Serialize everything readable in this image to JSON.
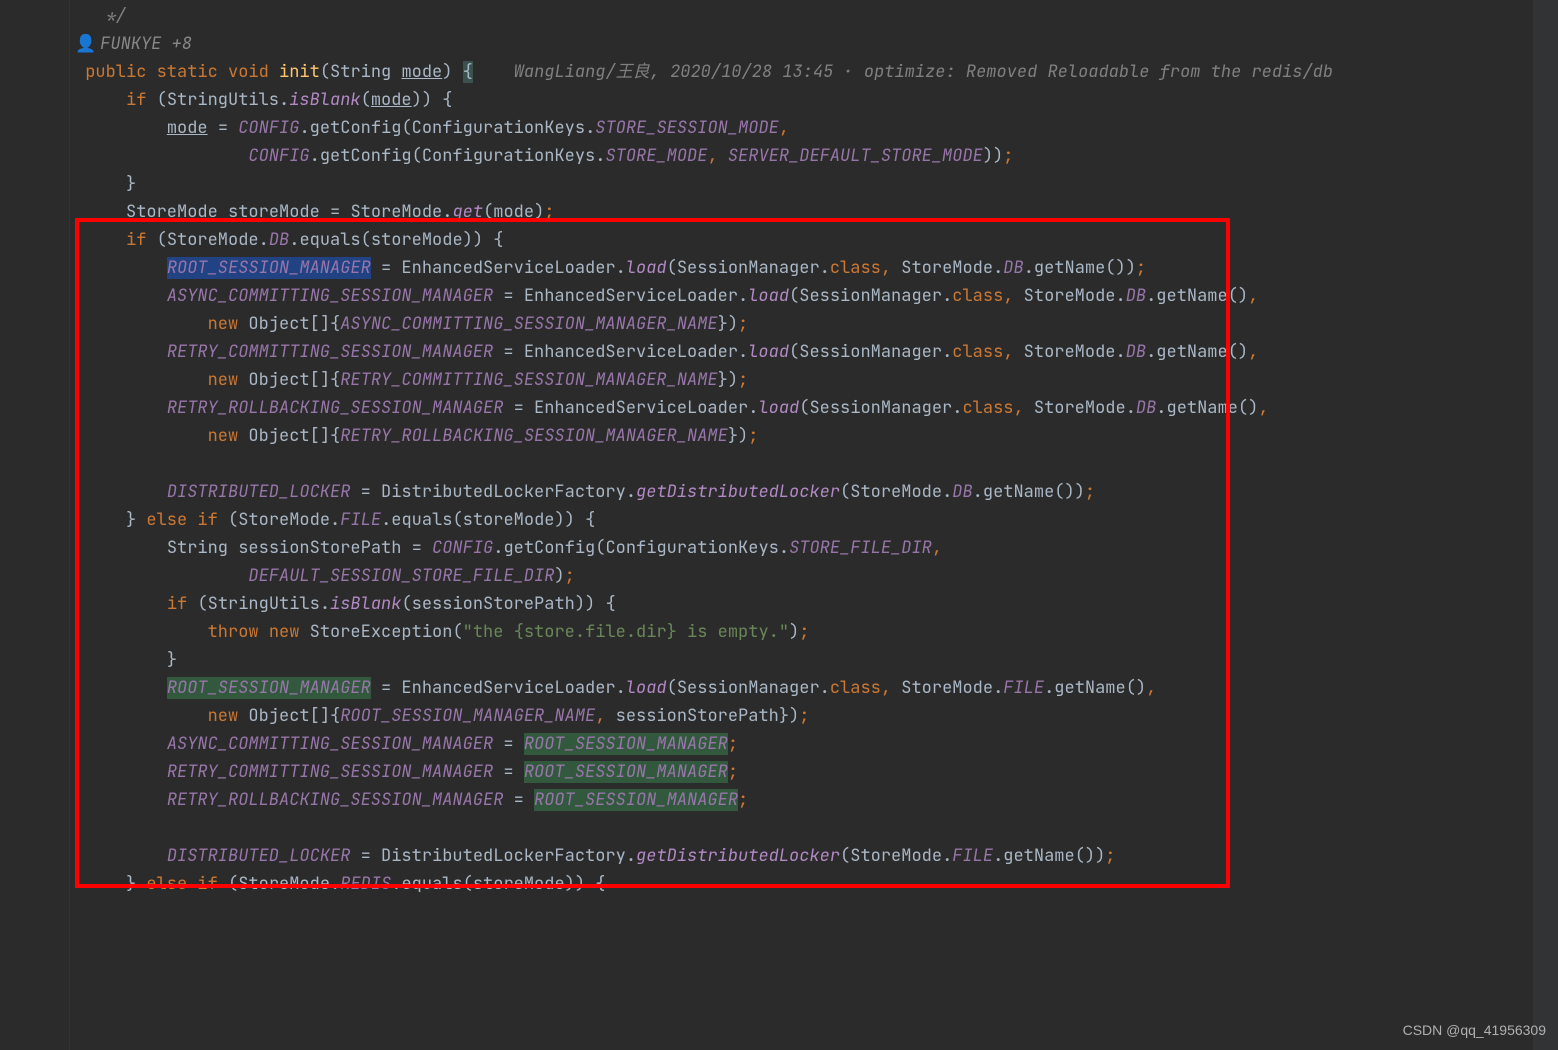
{
  "author_line": "FUNKYE +8",
  "inline_comment": "WangLiang/王良, 2020/10/28 13:45 · optimize: Removed Reloadable from the redis/db",
  "watermark": "CSDN @qq_41956309",
  "tokens": {
    "comment_end": "   */",
    "public": "public",
    "static": "static",
    "void": "void",
    "init": "init",
    "String": "String",
    "mode": "mode",
    "if": "if",
    "else": "else",
    "StringUtils": "StringUtils",
    "isBlank": "isBlank",
    "CONFIG": "CONFIG",
    "getConfig": "getConfig",
    "ConfigurationKeys": "ConfigurationKeys",
    "STORE_SESSION_MODE": "STORE_SESSION_MODE",
    "STORE_MODE": "STORE_MODE",
    "SERVER_DEFAULT_STORE_MODE": "SERVER_DEFAULT_STORE_MODE",
    "StoreMode": "StoreMode",
    "storeMode": "storeMode",
    "get": "get",
    "DB": "DB",
    "FILE": "FILE",
    "REDIS": "REDIS",
    "equals": "equals",
    "ROOT_SESSION_MANAGER": "ROOT_SESSION_MANAGER",
    "EnhancedServiceLoader": "EnhancedServiceLoader",
    "load": "load",
    "SessionManager": "SessionManager",
    "class": "class",
    "getName": "getName",
    "ASYNC_COMMITTING_SESSION_MANAGER": "ASYNC_COMMITTING_SESSION_MANAGER",
    "ASYNC_COMMITTING_SESSION_MANAGER_NAME": "ASYNC_COMMITTING_SESSION_MANAGER_NAME",
    "RETRY_COMMITTING_SESSION_MANAGER": "RETRY_COMMITTING_SESSION_MANAGER",
    "RETRY_COMMITTING_SESSION_MANAGER_NAME": "RETRY_COMMITTING_SESSION_MANAGER_NAME",
    "RETRY_ROLLBACKING_SESSION_MANAGER": "RETRY_ROLLBACKING_SESSION_MANAGER",
    "RETRY_ROLLBACKING_SESSION_MANAGER_NAME": "RETRY_ROLLBACKING_SESSION_MANAGER_NAME",
    "new": "new",
    "Object": "Object",
    "DISTRIBUTED_LOCKER": "DISTRIBUTED_LOCKER",
    "DistributedLockerFactory": "DistributedLockerFactory",
    "getDistributedLocker": "getDistributedLocker",
    "sessionStorePath": "sessionStorePath",
    "STORE_FILE_DIR": "STORE_FILE_DIR",
    "DEFAULT_SESSION_STORE_FILE_DIR": "DEFAULT_SESSION_STORE_FILE_DIR",
    "throw": "throw",
    "StoreException": "StoreException",
    "err_string": "\"the {store.file.dir} is empty.\"",
    "ROOT_SESSION_MANAGER_NAME": "ROOT_SESSION_MANAGER_NAME"
  }
}
